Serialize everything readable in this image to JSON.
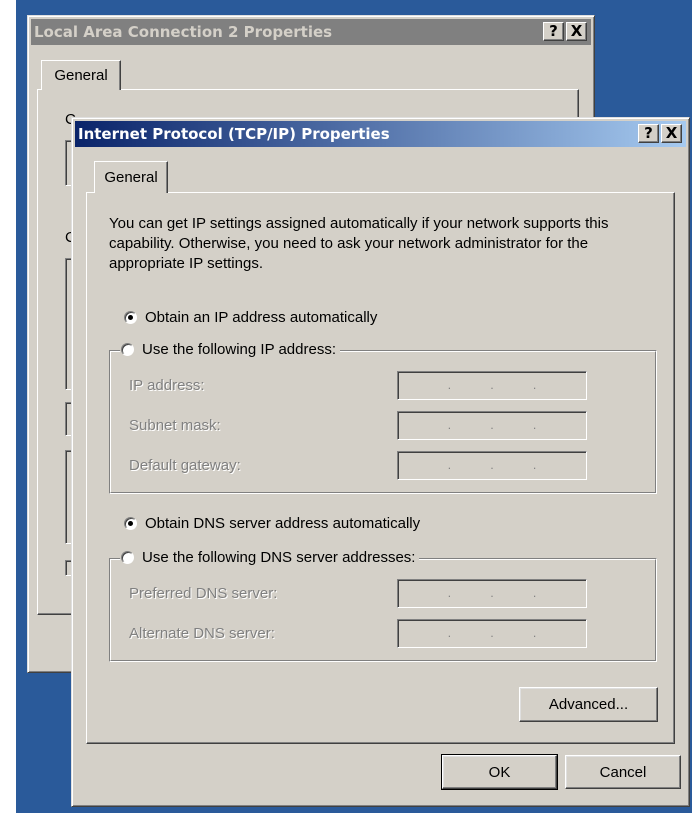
{
  "back_window": {
    "title": "Local Area Connection 2 Properties",
    "tab": "General",
    "help_glyph": "?",
    "close_glyph": "X",
    "clipped_letters": [
      "C",
      "C"
    ]
  },
  "dialog": {
    "title": "Internet Protocol (TCP/IP) Properties",
    "help_glyph": "?",
    "close_glyph": "X",
    "tab": "General",
    "description": "You can get IP settings assigned automatically if your network supports this capability. Otherwise, you need to ask your network administrator for the appropriate IP settings.",
    "ip_auto_label": "Obtain an IP address automatically",
    "ip_manual_label": "Use the following IP address:",
    "ip_fields": {
      "ip_address": "IP address:",
      "subnet_mask": "Subnet mask:",
      "default_gateway": "Default gateway:"
    },
    "dns_auto_label": "Obtain DNS server address automatically",
    "dns_manual_label": "Use the following DNS server addresses:",
    "dns_fields": {
      "preferred": "Preferred DNS server:",
      "alternate": "Alternate DNS server:"
    },
    "ip_dot": ".",
    "advanced_label": "Advanced...",
    "ok_label": "OK",
    "cancel_label": "Cancel",
    "selected": {
      "ip_mode": "automatic",
      "dns_mode": "automatic"
    }
  },
  "colors": {
    "desktop": "#2a5a9a",
    "face": "#d4d0c8",
    "active_title_start": "#0a246a",
    "active_title_end": "#a6caf0",
    "inactive_title": "#808080"
  }
}
